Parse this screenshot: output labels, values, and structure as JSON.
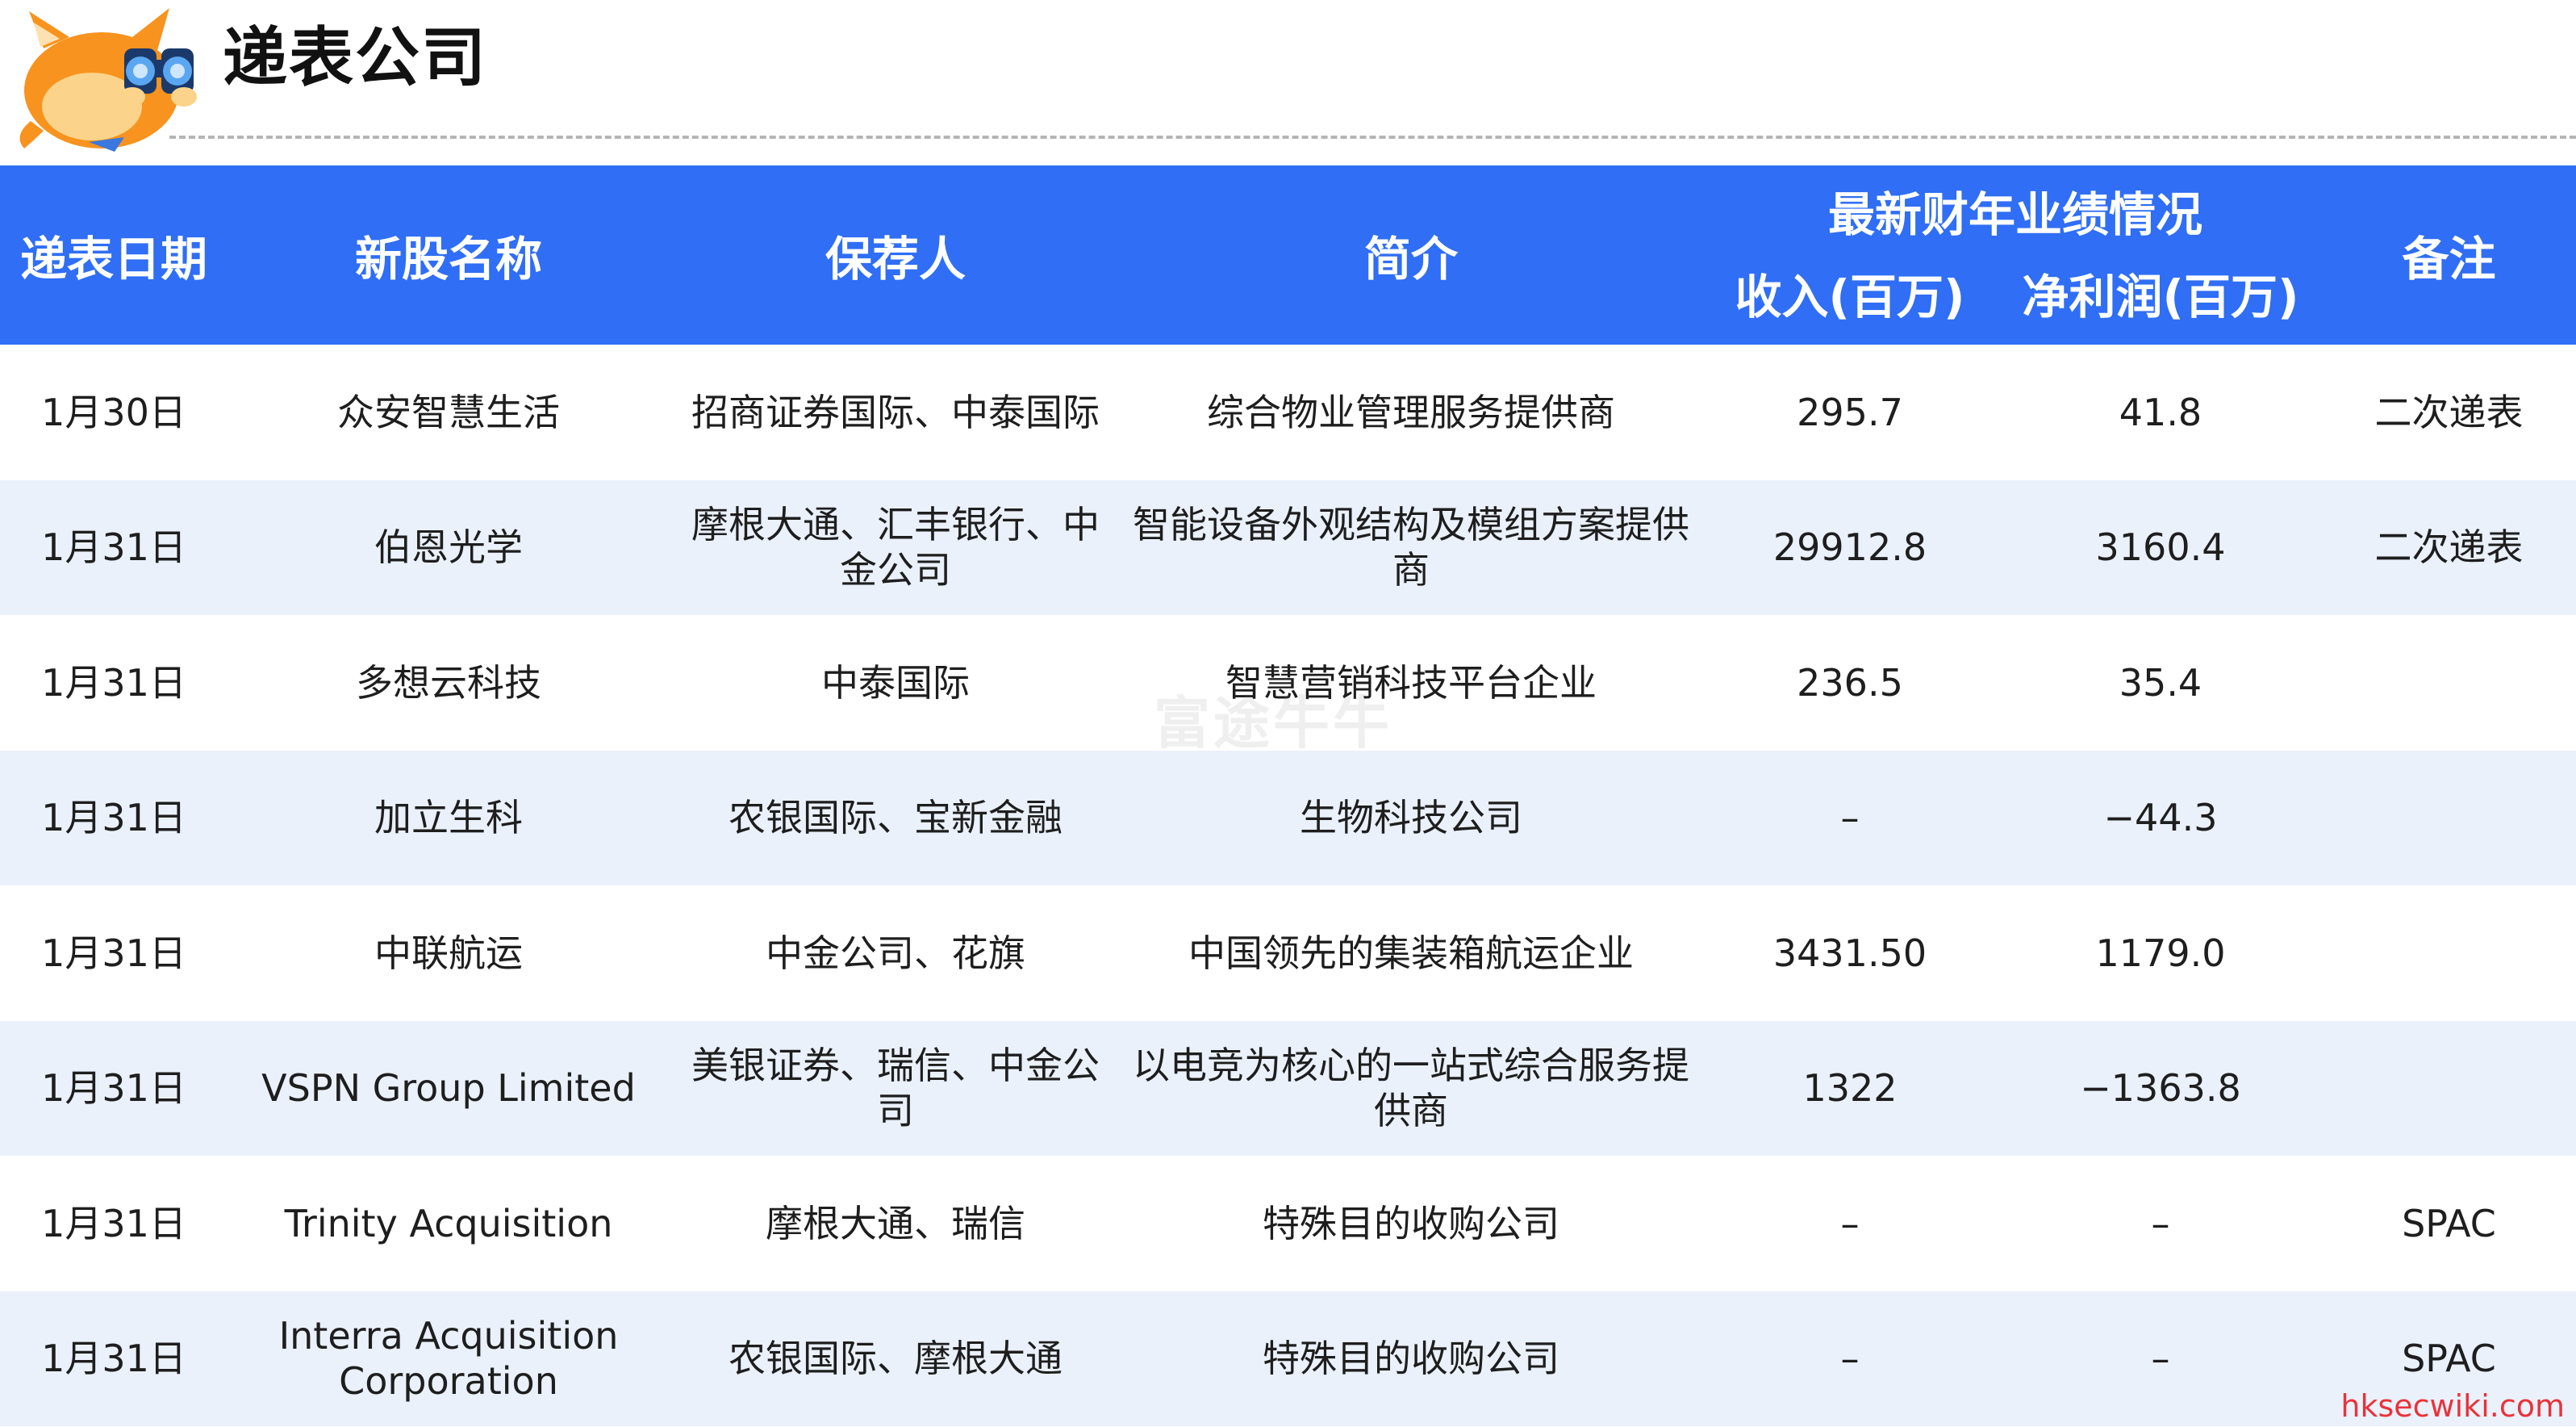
{
  "page": {
    "title": "递表公司",
    "watermark": "富途牛牛",
    "source": "hksecwiki.com"
  },
  "colors": {
    "header_bg": "#2f6ef5",
    "header_text": "#ffffff",
    "row_alt_bg": "#eaf1fb",
    "source_text": "#e8333a"
  },
  "table": {
    "headers": {
      "date": "递表日期",
      "name": "新股名称",
      "sponsor": "保荐人",
      "description": "简介",
      "performance_group": "最新财年业绩情况",
      "revenue": "收入(百万)",
      "net_profit": "净利润(百万)",
      "note": "备注"
    },
    "rows": [
      {
        "date": "1月30日",
        "name": "众安智慧生活",
        "sponsor": "招商证券国际、中泰国际",
        "description": "综合物业管理服务提供商",
        "revenue": "295.7",
        "net_profit": "41.8",
        "note": "二次递表"
      },
      {
        "date": "1月31日",
        "name": "伯恩光学",
        "sponsor": "摩根大通、汇丰银行、中金公司",
        "description": "智能设备外观结构及模组方案提供商",
        "revenue": "29912.8",
        "net_profit": "3160.4",
        "note": "二次递表"
      },
      {
        "date": "1月31日",
        "name": "多想云科技",
        "sponsor": "中泰国际",
        "description": "智慧营销科技平台企业",
        "revenue": "236.5",
        "net_profit": "35.4",
        "note": ""
      },
      {
        "date": "1月31日",
        "name": "加立生科",
        "sponsor": "农银国际、宝新金融",
        "description": "生物科技公司",
        "revenue": "–",
        "net_profit": "−44.3",
        "note": ""
      },
      {
        "date": "1月31日",
        "name": "中联航运",
        "sponsor": "中金公司、花旗",
        "description": "中国领先的集装箱航运企业",
        "revenue": "3431.50",
        "net_profit": "1179.0",
        "note": ""
      },
      {
        "date": "1月31日",
        "name": "VSPN Group Limited",
        "sponsor": "美银证券、瑞信、中金公司",
        "description": "以电竞为核心的一站式综合服务提供商",
        "revenue": "1322",
        "net_profit": "−1363.8",
        "note": ""
      },
      {
        "date": "1月31日",
        "name": "Trinity Acquisition",
        "sponsor": "摩根大通、瑞信",
        "description": "特殊目的收购公司",
        "revenue": "–",
        "net_profit": "–",
        "note": "SPAC"
      },
      {
        "date": "1月31日",
        "name": "Interra Acquisition Corporation",
        "sponsor": "农银国际、摩根大通",
        "description": "特殊目的收购公司",
        "revenue": "–",
        "net_profit": "–",
        "note": "SPAC"
      }
    ]
  }
}
